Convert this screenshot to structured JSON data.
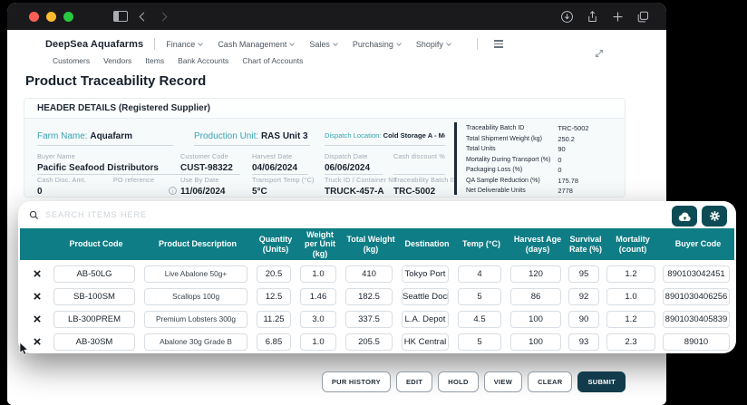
{
  "colors": {
    "table_header": "#0F7D85",
    "accent_label_teal": "#38A3B1",
    "dark_icon_button": "#0D4C55",
    "submit_button": "#123C4B",
    "traffic_red": "#FF5F57",
    "traffic_yellow": "#FEBC2E",
    "traffic_green": "#28C840"
  },
  "icons": {
    "window_controls": [
      "close",
      "minimize",
      "zoom"
    ],
    "chrome": [
      "sidebar-icon",
      "back-icon",
      "forward-icon",
      "download-icon",
      "share-icon",
      "new-tab-icon",
      "tabs-icon"
    ],
    "page": [
      "hamburger-icon",
      "expand-icon",
      "search-icon",
      "cloud-upload-icon",
      "gear-icon",
      "info-icon",
      "remove-x-icon",
      "cursor-arrow"
    ]
  },
  "nav": {
    "brand": "DeepSea Aquafarms",
    "menus": [
      "Finance",
      "Cash Management",
      "Sales",
      "Purchasing",
      "Shopify"
    ],
    "subnav": [
      "Customers",
      "Vendors",
      "Items",
      "Bank Accounts",
      "Chart of Accounts"
    ]
  },
  "page": {
    "title": "Product Traceability Record"
  },
  "header_details": {
    "section_title": "HEADER DETAILS (Registered Supplier)",
    "row1": [
      {
        "label": "Farm Name:",
        "value": "Aquafarm"
      },
      {
        "label": "Production Unit:",
        "value": "RAS Unit 3"
      },
      {
        "label": "Dispatch Location:",
        "value": "Cold Storage A - Monterey"
      }
    ],
    "row2": [
      {
        "label": "Buyer Name",
        "value": "Pacific Seafood Distributors"
      },
      {
        "label": "Customer Code",
        "value": "CUST-98322"
      },
      {
        "label": "Harvest Date",
        "value": "04/06/2024"
      },
      {
        "label": "Dispatch Date",
        "value": "06/06/2024"
      },
      {
        "label": "Cash discount %",
        "value": ""
      }
    ],
    "row3": [
      {
        "label": "Cash Disc. Amt.",
        "value": "0"
      },
      {
        "label": "PO reference",
        "value": ""
      },
      {
        "label": "Use By Date",
        "value": "11/06/2024"
      },
      {
        "label": "Transport Temp (°C)",
        "value": "5°C"
      },
      {
        "label": "Truck ID / Container No",
        "value": "TRUCK-457-A"
      },
      {
        "label": "Traceability Batch ID",
        "value": "TRC-5002"
      }
    ],
    "summary": [
      {
        "label": "Traceability Batch ID",
        "value": "TRC-5002"
      },
      {
        "label": "Total Shipment Weight (kg)",
        "value": "250.2"
      },
      {
        "label": "Total Units",
        "value": "90"
      },
      {
        "label": "Mortality During Transport (%)",
        "value": "0"
      },
      {
        "label": "Packaging Loss (%)",
        "value": "0"
      },
      {
        "label": "QA Sample Reduction (%)",
        "value": "175.78"
      },
      {
        "label": "Net Deliverable Units",
        "value": "2778"
      }
    ]
  },
  "items_table": {
    "search_placeholder": "SEARCH ITEMS HERE",
    "remove_glyph": "×",
    "columns": [
      "Product Code",
      "Product Description",
      "Quantity (Units)",
      "Weight per Unit (kg)",
      "Total Weight (kg)",
      "Destination",
      "Temp (°C)",
      "Harvest Age (days)",
      "Survival Rate (%)",
      "Mortality (count)",
      "Buyer Code"
    ],
    "rows": [
      [
        "AB-50LG",
        "Live Abalone 50g+",
        "20.5",
        "1.0",
        "410",
        "Tokyo Port",
        "4",
        "120",
        "95",
        "1.2",
        "890103042451"
      ],
      [
        "SB-100SM",
        "Scallops 100g",
        "12.5",
        "1.46",
        "182.5",
        "Seattle Dock",
        "5",
        "86",
        "92",
        "1.0",
        "8901030406256"
      ],
      [
        "LB-300PREM",
        "Premium Lobsters 300g",
        "11.25",
        "3.0",
        "337.5",
        "L.A. Depot",
        "4.5",
        "100",
        "90",
        "1.2",
        "8901030405839"
      ],
      [
        "AB-30SM",
        "Abalone 30g Grade B",
        "6.85",
        "1.0",
        "205.5",
        "HK Central",
        "5",
        "100",
        "93",
        "2.3",
        "89010"
      ]
    ]
  },
  "actions": {
    "buttons": [
      "PUR HISTORY",
      "EDIT",
      "HOLD",
      "VIEW",
      "CLEAR"
    ],
    "submit_label": "SUBMIT"
  }
}
